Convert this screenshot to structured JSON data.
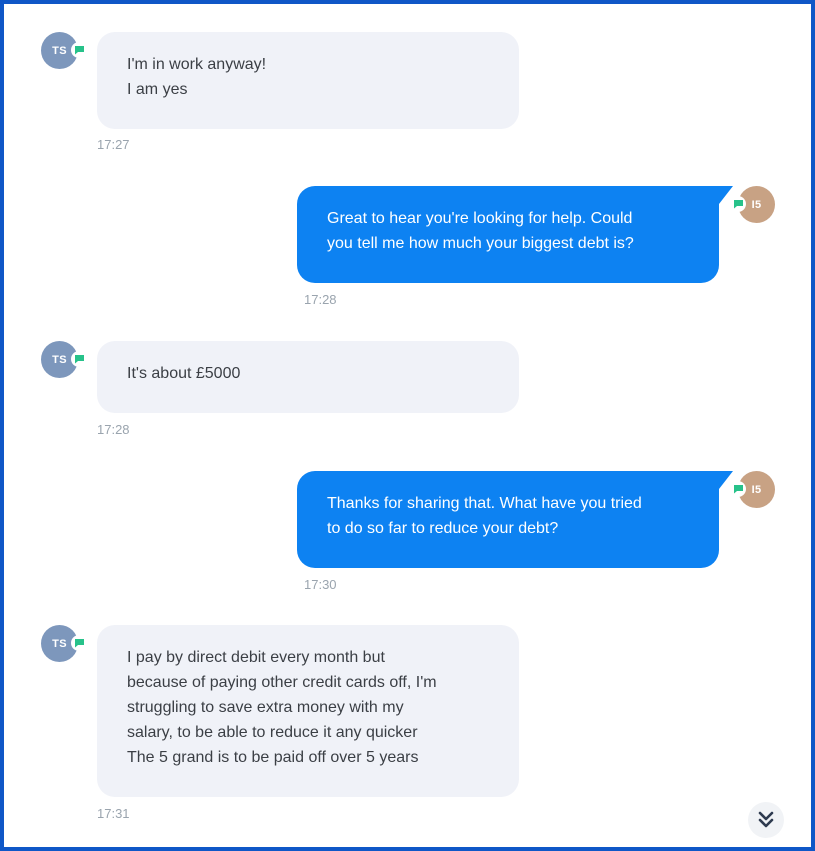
{
  "colors": {
    "frame_border": "#0f57c7",
    "user_bubble": "#f0f2f8",
    "agent_bubble": "#0d82f2",
    "user_avatar": "#7d97bc",
    "agent_avatar": "#c8a284",
    "status_badge": "#27c28a",
    "timestamp": "#9aa4ae"
  },
  "messages": [
    {
      "sender": "user",
      "avatar": "TS",
      "text": "I'm in work anyway!\nI am yes",
      "time": "17:27"
    },
    {
      "sender": "agent",
      "avatar": "I5",
      "text": "Great to hear you're looking for help. Could\nyou tell me how much your biggest debt is?",
      "time": "17:28"
    },
    {
      "sender": "user",
      "avatar": "TS",
      "text": "It's about £5000",
      "time": "17:28"
    },
    {
      "sender": "agent",
      "avatar": "I5",
      "text": "Thanks for sharing that. What have you tried\nto do so far to reduce your debt?",
      "time": "17:30"
    },
    {
      "sender": "user",
      "avatar": "TS",
      "text": "I pay by direct debit every month but\nbecause of paying other credit cards off, I'm\nstruggling to save extra money with my\nsalary, to be able to reduce it any quicker\nThe 5 grand is to be paid off over 5 years",
      "time": "17:31"
    }
  ],
  "scroll_button": {
    "icon": "double-chevron-down-icon"
  }
}
